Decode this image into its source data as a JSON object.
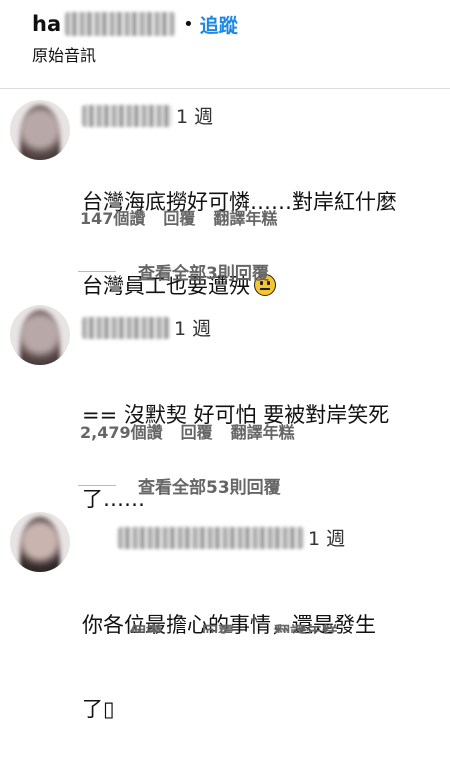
{
  "header": {
    "username_prefix": "ha",
    "separator": "•",
    "follow_label": "追蹤",
    "subtitle": "原始音訊"
  },
  "comments": [
    {
      "time": "1 週",
      "lines": [
        "台灣海底撈好可憐……對岸紅什麼",
        "台灣員工也要遭殃"
      ],
      "emoji": "neutral-face",
      "likes": "147個讚",
      "reply": "回覆",
      "translate": "翻譯年糕",
      "view_replies": "查看全部3則回覆"
    },
    {
      "time": "1 週",
      "lines": [
        "== 沒默契 好可怕 要被對岸笑死",
        "了……"
      ],
      "likes": "2,479個讚",
      "reply": "回覆",
      "translate": "翻譯年糕",
      "view_replies": "查看全部53則回覆"
    },
    {
      "time": "1 週",
      "lines": [
        "你各位最擔心的事情，還是發生",
        "了▯"
      ],
      "likes": "個讚",
      "reply": "回覆",
      "translate": "翻譯年糕"
    }
  ]
}
